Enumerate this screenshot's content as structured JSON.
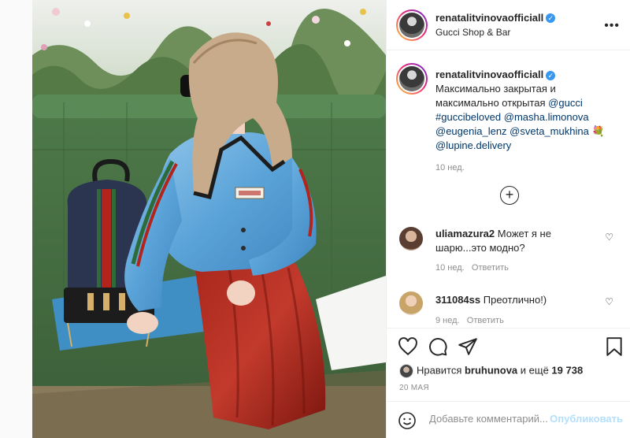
{
  "post": {
    "username": "renatalitvinovaofficiall",
    "verified_mark": "✓",
    "location": "Gucci Shop & Bar",
    "more_icon": "more-horizontal-icon"
  },
  "caption": {
    "username": "renatalitvinovaofficiall",
    "text_line1": "Максимально закрытая и",
    "text_line2": "максимально открытая ",
    "mention_gucci": "@gucci",
    "hashtag": "#guccibeloved",
    "mention_masha": "@masha.limonova",
    "mention_eugenia": "@eugenia_lenz",
    "mention_sveta": "@sveta_mukhina",
    "emoji": "💐",
    "mention_lupine": "@lupine.delivery",
    "age": "10 нед."
  },
  "load_more": "+",
  "comments": [
    {
      "username": "uliamazura2",
      "text": "Может я не шарю...это модно?",
      "age": "10 нед.",
      "reply": "Ответить"
    },
    {
      "username": "311084ss",
      "text": "Преотлично!)",
      "age": "9 нед.",
      "reply": "Ответить"
    }
  ],
  "likes": {
    "prefix": "Нравится ",
    "user": "bruhunova",
    "middle": " и ещё ",
    "count": "19 738"
  },
  "date": "20 МАЯ",
  "comment_input": {
    "placeholder": "Добавьте комментарий...",
    "publish_label": "Опубликовать"
  },
  "colors": {
    "link": "#00376b",
    "verified": "#3897f0",
    "publish_disabled": "#b2dffc",
    "muted": "#8e8e8e"
  }
}
